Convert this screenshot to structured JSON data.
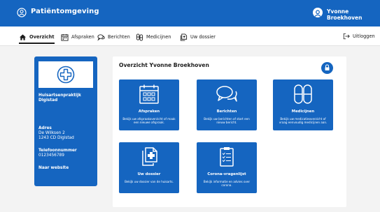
{
  "header": {
    "title": "Patiëntomgeving",
    "user_name": "Yvonne Broekhoven"
  },
  "nav": {
    "items": [
      {
        "label": "Overzicht",
        "icon": "home-icon"
      },
      {
        "label": "Afspraken",
        "icon": "calendar-icon"
      },
      {
        "label": "Berichten",
        "icon": "chat-icon"
      },
      {
        "label": "Medicijnen",
        "icon": "pills-icon"
      },
      {
        "label": "Uw dossier",
        "icon": "file-icon"
      }
    ],
    "logout_label": "Uitloggen"
  },
  "sidebar": {
    "practice_name_line1": "Huisartsenpraktijk",
    "practice_name_line2": "Digistad",
    "address_label": "Adres",
    "address_line1": "De Wilksen 2",
    "address_line2": "1243 CD Digistad",
    "phone_label": "Telefoonnummer",
    "phone_value": "0123456789",
    "website_link": "Naar website"
  },
  "main": {
    "title": "Overzicht Yvonne Broekhoven",
    "tiles": [
      {
        "title": "Afspraken",
        "description": "Bekijk uw afspraakoverzicht of maak een nieuwe afspraak.",
        "icon": "calendar-icon"
      },
      {
        "title": "Berichten",
        "description": "Bekijk uw berichten of start een nieuw bericht.",
        "icon": "chat-icon"
      },
      {
        "title": "Medicijnen",
        "description": "Bekijk uw medicatieoverzicht of vraag eenvoudig medicijnen aan.",
        "icon": "pills-icon"
      },
      {
        "title": "Uw dossier",
        "description": "Bekijk uw dossier van de huisarts.",
        "icon": "file-plus-icon"
      },
      {
        "title": "Corona-vragenlijst",
        "description": "Bekijk informatie en advies over corona.",
        "icon": "clipboard-icon"
      }
    ]
  },
  "colors": {
    "primary": "#1565c0",
    "background": "#f3f3f3",
    "surface": "#ffffff"
  }
}
